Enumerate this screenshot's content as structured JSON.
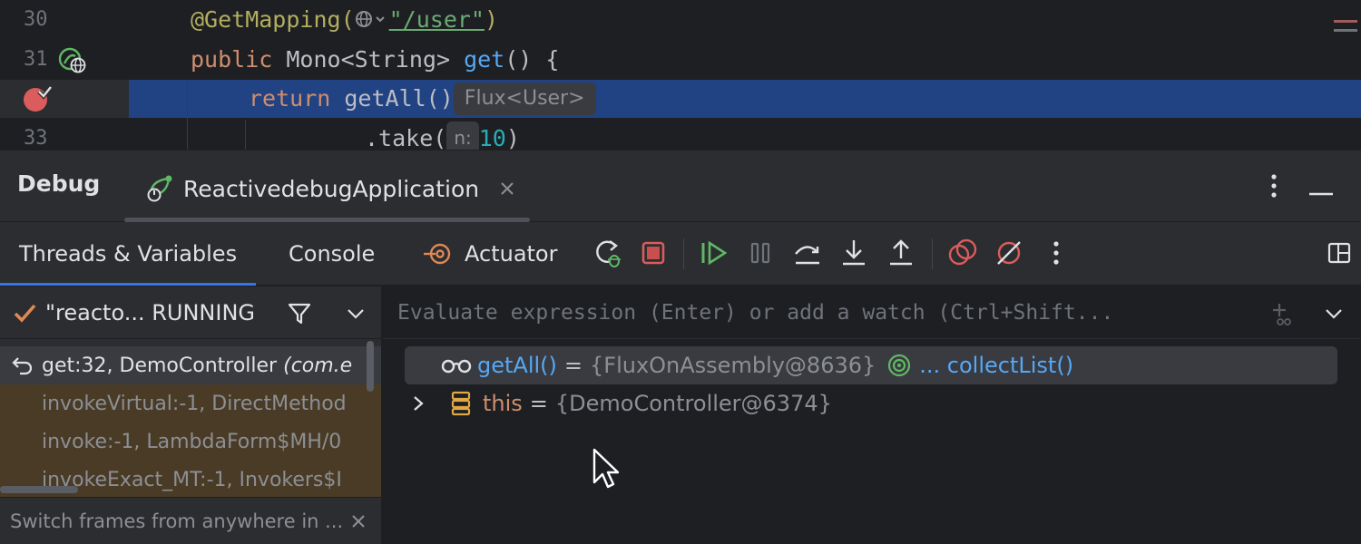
{
  "editor": {
    "lines": [
      {
        "number": "30",
        "annotation": "@GetMapping(",
        "mapping_path": "\"/user\"",
        "close": ")"
      },
      {
        "number": "31",
        "kw": "public",
        "type": "Mono<String>",
        "method": "get",
        "rest": "() {"
      },
      {
        "number": "",
        "kw": "return",
        "call": "getAll()",
        "type_hint": "Flux<User>"
      },
      {
        "number": "33",
        "chain": ".take(",
        "param_hint": "n:",
        "arg": "10",
        "close": ")"
      }
    ]
  },
  "debug": {
    "title": "Debug",
    "session_tab": "ReactivedebugApplication"
  },
  "toolbar": {
    "tabs": [
      {
        "label": "Threads & Variables",
        "active": true
      },
      {
        "label": "Console",
        "active": false
      },
      {
        "label": "Actuator",
        "active": false
      }
    ],
    "actions": [
      "rerun-icon",
      "stop-icon",
      "resume-icon",
      "pause-icon",
      "step-over-icon",
      "step-into-icon",
      "step-out-icon",
      "view-breakpoints-icon",
      "mute-breakpoints-icon",
      "more-icon"
    ]
  },
  "frames": {
    "thread_label": "\"reacto... RUNNING",
    "items": [
      {
        "method": "get:32, DemoController",
        "location": "(com.e",
        "kind": "current"
      },
      {
        "method": "invokeVirtual:-1, DirectMethod",
        "location": "",
        "kind": "lib"
      },
      {
        "method": "invoke:-1, LambdaForm$MH/0",
        "location": "",
        "kind": "lib"
      },
      {
        "method": "invokeExact_MT:-1, Invokers$I",
        "location": "",
        "kind": "lib"
      }
    ],
    "hint": "Switch frames from anywhere in ..."
  },
  "variables": {
    "eval_placeholder": "Evaluate expression (Enter) or add a watch (Ctrl+Shift...",
    "items": [
      {
        "name": "getAll()",
        "eq": "=",
        "value": "{FluxOnAssembly@8636}",
        "link": "... collectList()"
      },
      {
        "name": "this",
        "eq": "=",
        "value": "{DemoController@6374}"
      }
    ]
  },
  "colors": {
    "editor_bg": "#1e1f22",
    "panel_bg": "#2b2d30",
    "execution_line": "#214283",
    "accent": "#3574f0",
    "breakpoint": "#db5c5c",
    "run_green": "#5fb865",
    "library_frame_bg": "#4a3b26"
  }
}
